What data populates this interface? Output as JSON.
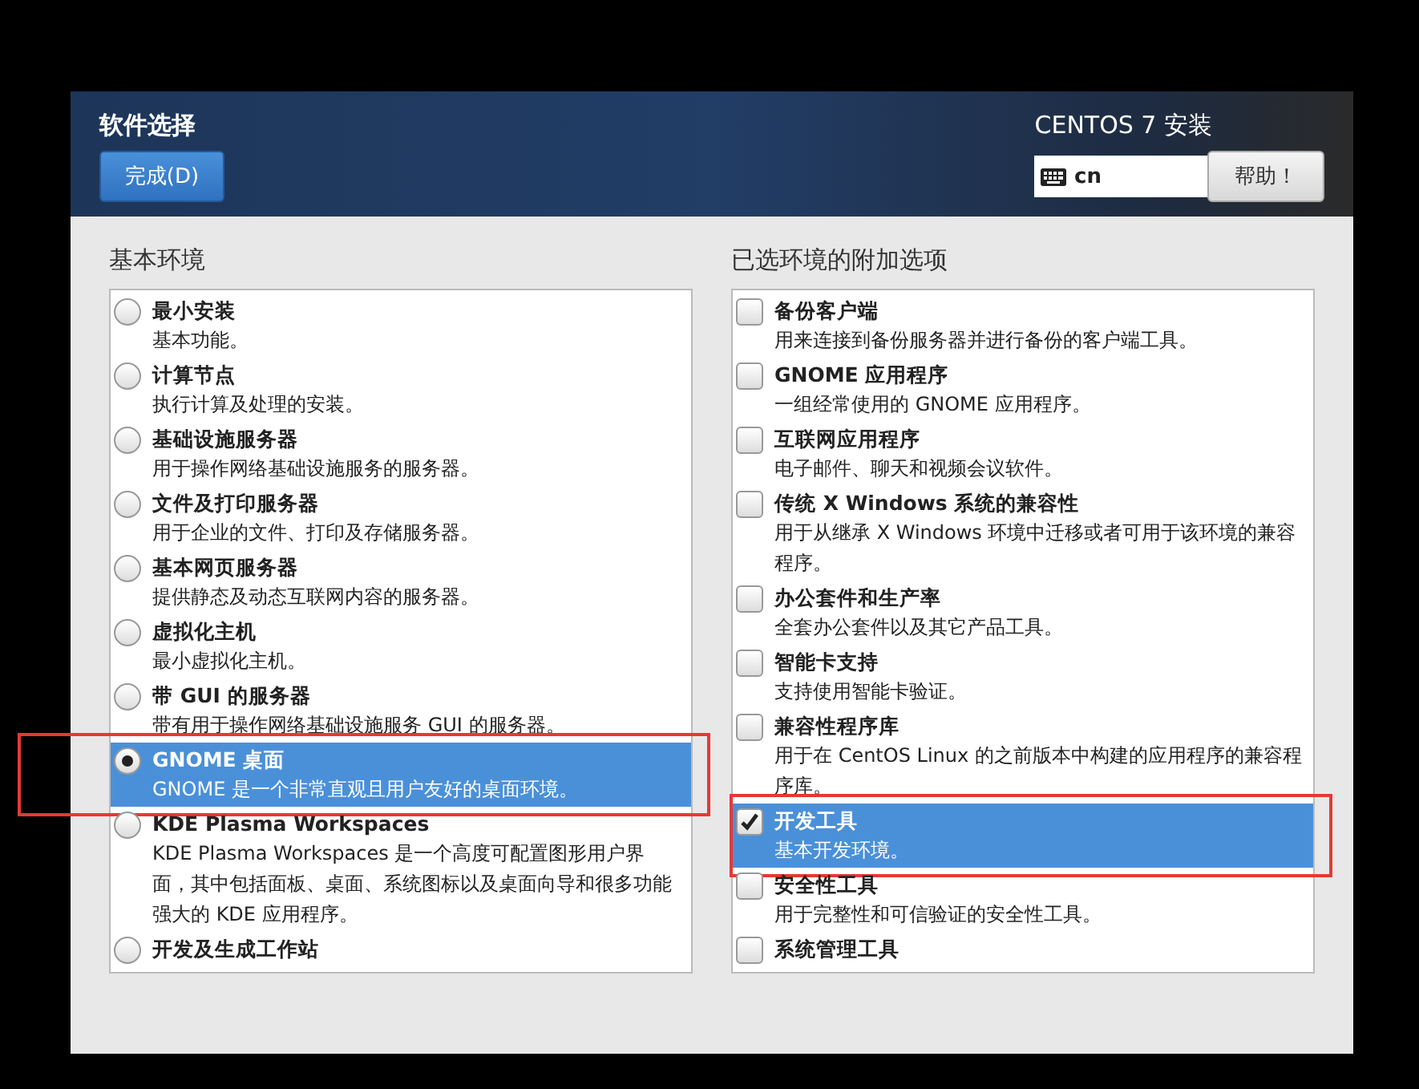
{
  "header": {
    "title": "软件选择",
    "done_button": "完成(D)",
    "product": "CENTOS 7 安装",
    "keyboard": "cn",
    "help_button": "帮助！"
  },
  "base_environment": {
    "heading": "基本环境",
    "items": [
      {
        "title": "最小安装",
        "description": "基本功能。",
        "selected": false,
        "annotated": false
      },
      {
        "title": "计算节点",
        "description": "执行计算及处理的安装。",
        "selected": false,
        "annotated": false
      },
      {
        "title": "基础设施服务器",
        "description": "用于操作网络基础设施服务的服务器。",
        "selected": false,
        "annotated": false
      },
      {
        "title": "文件及打印服务器",
        "description": "用于企业的文件、打印及存储服务器。",
        "selected": false,
        "annotated": false
      },
      {
        "title": "基本网页服务器",
        "description": "提供静态及动态互联网内容的服务器。",
        "selected": false,
        "annotated": false
      },
      {
        "title": "虚拟化主机",
        "description": "最小虚拟化主机。",
        "selected": false,
        "annotated": false
      },
      {
        "title": "带 GUI 的服务器",
        "description": "带有用于操作网络基础设施服务 GUI 的服务器。",
        "selected": false,
        "annotated": false
      },
      {
        "title": "GNOME 桌面",
        "description": "GNOME 是一个非常直观且用户友好的桌面环境。",
        "selected": true,
        "annotated": true
      },
      {
        "title": "KDE Plasma Workspaces",
        "description": "KDE Plasma Workspaces 是一个高度可配置图形用户界面，其中包括面板、桌面、系统图标以及桌面向导和很多功能强大的 KDE 应用程序。",
        "selected": false,
        "annotated": false
      },
      {
        "title": "开发及生成工作站",
        "selected": false,
        "annotated": false
      }
    ]
  },
  "addons": {
    "heading": "已选环境的附加选项",
    "items": [
      {
        "title": "备份客户端",
        "description": "用来连接到备份服务器并进行备份的客户端工具。",
        "checked": false,
        "selected": false,
        "annotated": false
      },
      {
        "title": "GNOME 应用程序",
        "description": "一组经常使用的 GNOME 应用程序。",
        "checked": false,
        "selected": false,
        "annotated": false
      },
      {
        "title": "互联网应用程序",
        "description": "电子邮件、聊天和视频会议软件。",
        "checked": false,
        "selected": false,
        "annotated": false
      },
      {
        "title": "传统 X Windows 系统的兼容性",
        "description": "用于从继承 X Windows 环境中迁移或者可用于该环境的兼容程序。",
        "checked": false,
        "selected": false,
        "annotated": false
      },
      {
        "title": "办公套件和生产率",
        "description": "全套办公套件以及其它产品工具。",
        "checked": false,
        "selected": false,
        "annotated": false
      },
      {
        "title": "智能卡支持",
        "description": "支持使用智能卡验证。",
        "checked": false,
        "selected": false,
        "annotated": false
      },
      {
        "title": "兼容性程序库",
        "description": "用于在 CentOS Linux 的之前版本中构建的应用程序的兼容程序库。",
        "checked": false,
        "selected": false,
        "annotated": false
      },
      {
        "title": "开发工具",
        "description": "基本开发环境。",
        "checked": true,
        "selected": true,
        "annotated": true
      },
      {
        "title": "安全性工具",
        "description": "用于完整性和可信验证的安全性工具。",
        "checked": false,
        "selected": false,
        "annotated": false
      },
      {
        "title": "系统管理工具",
        "checked": false,
        "selected": false,
        "annotated": false
      }
    ]
  }
}
